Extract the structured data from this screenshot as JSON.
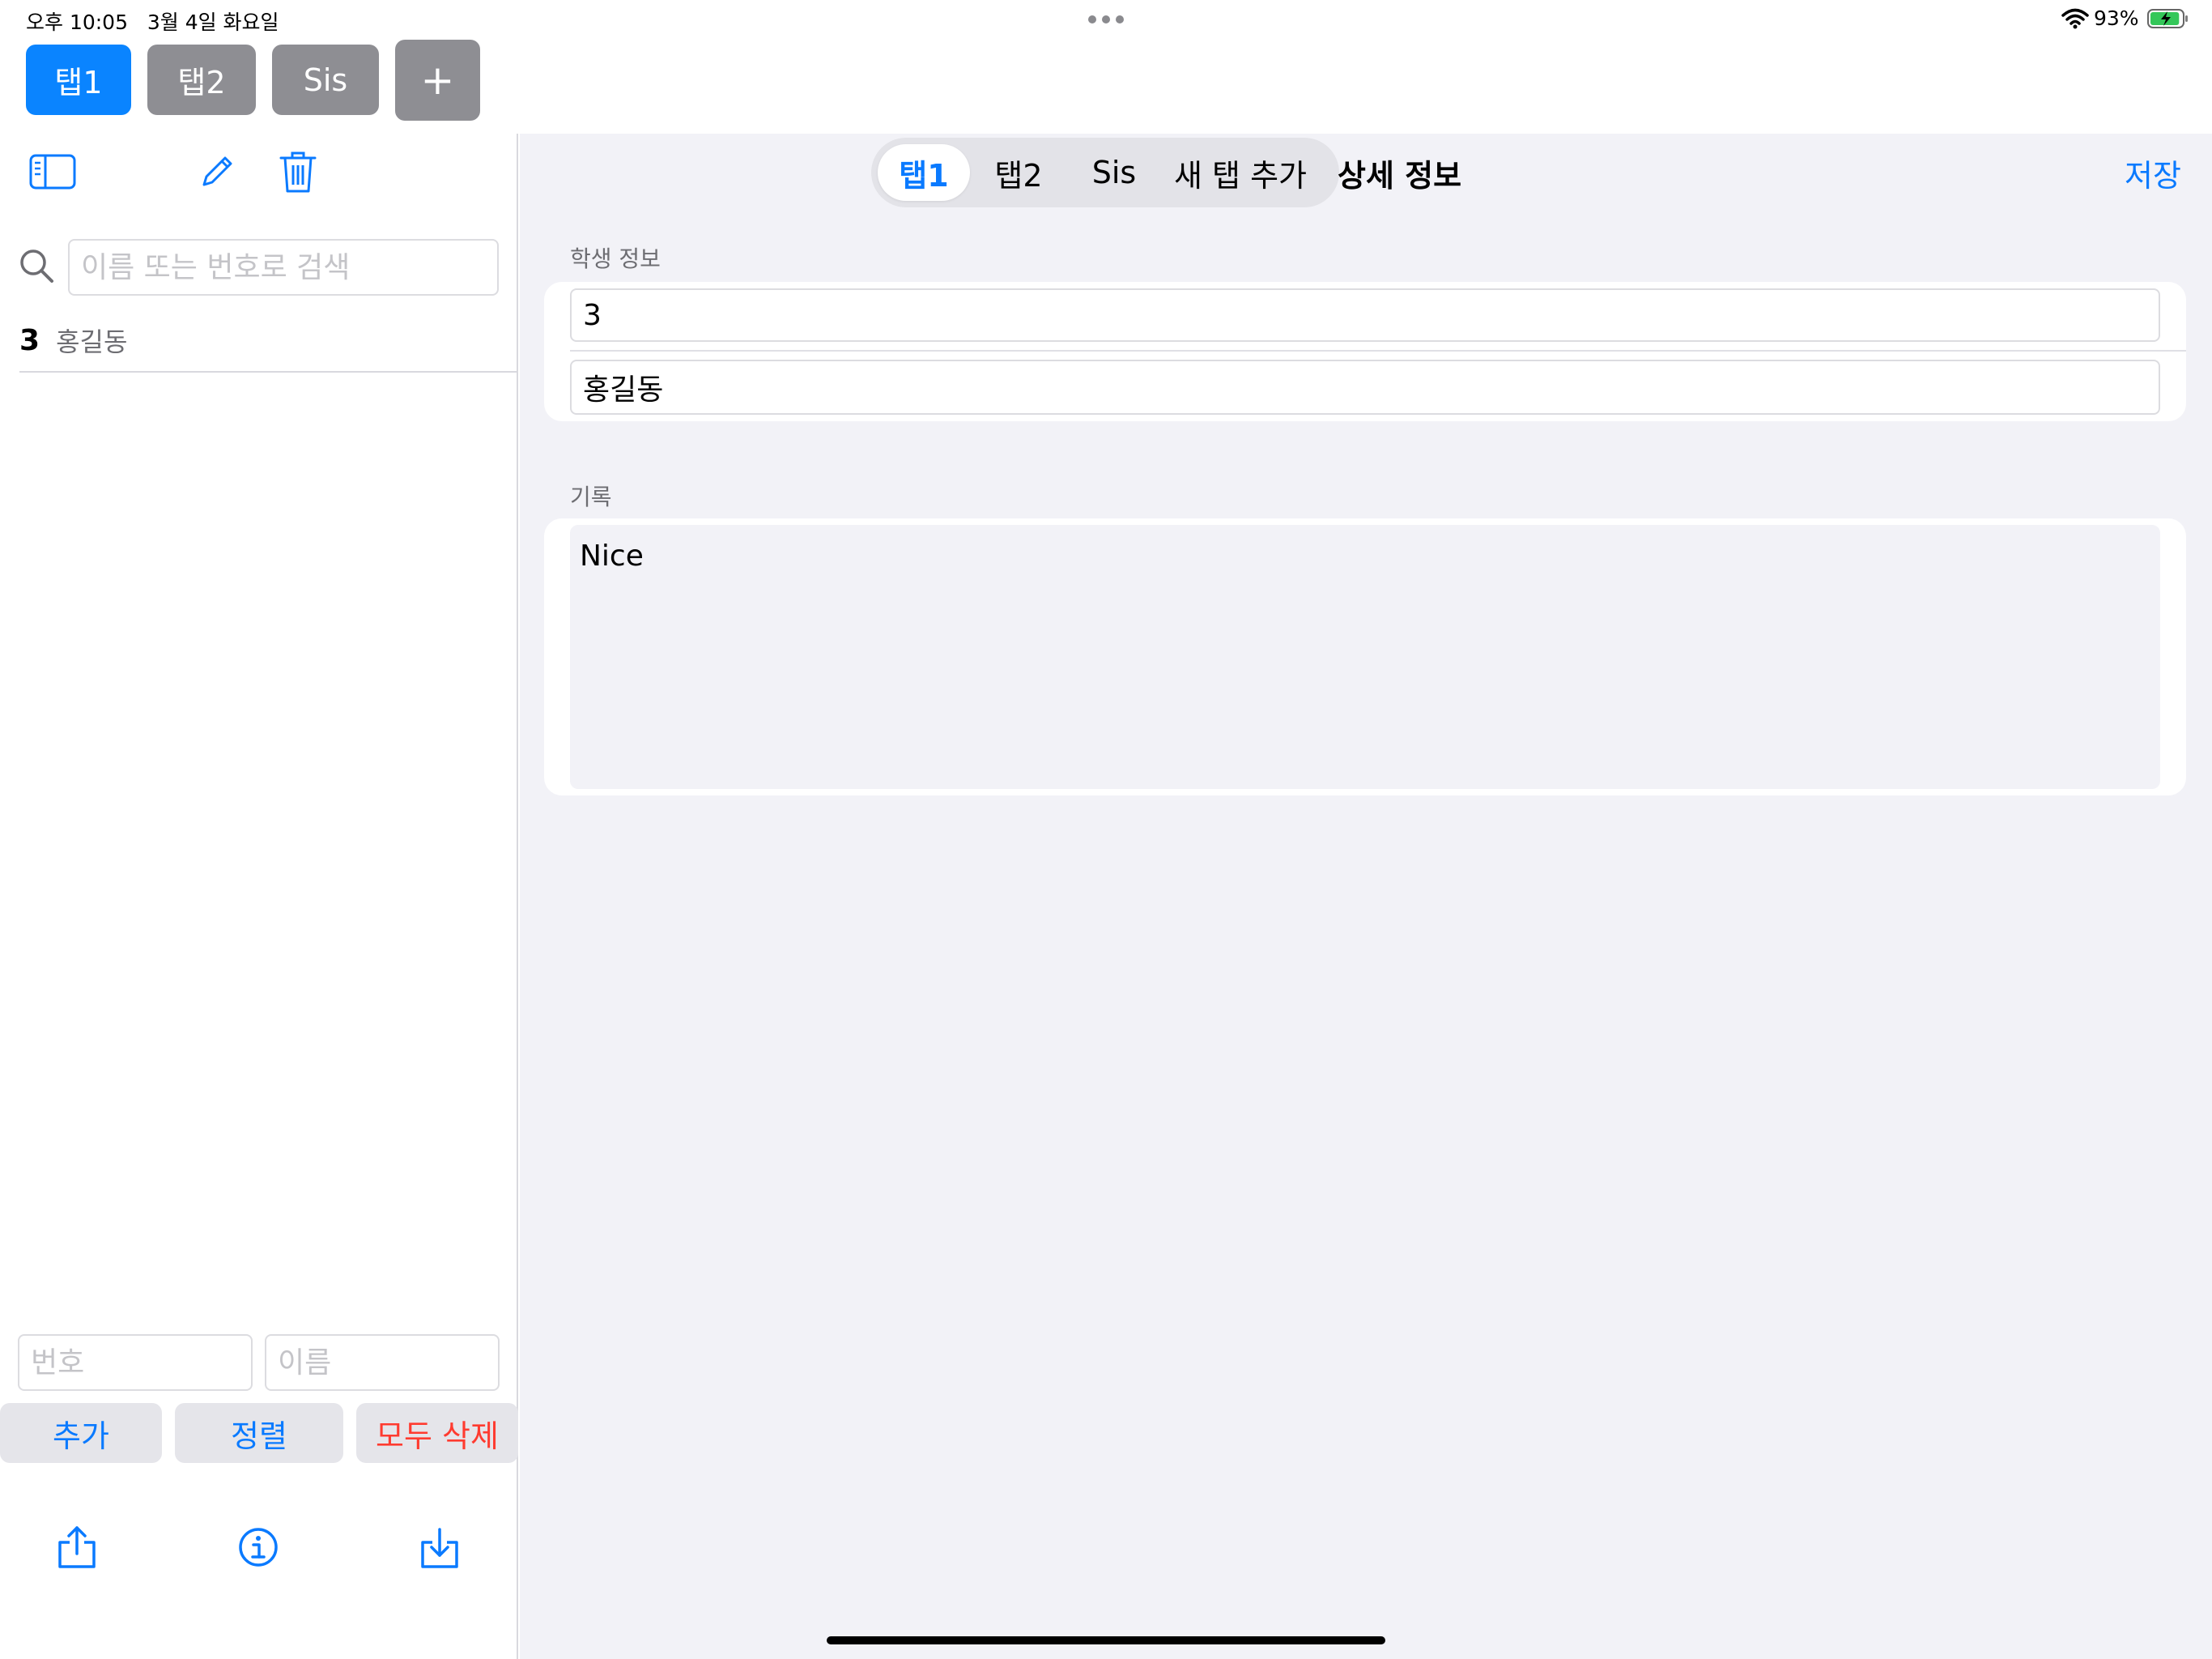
{
  "status_bar": {
    "time": "오후 10:05",
    "date": "3월 4일 화요일",
    "battery_percent": "93%",
    "battery_level": 0.93
  },
  "top_tabs": [
    {
      "label": "탭1",
      "active": true
    },
    {
      "label": "탭2",
      "active": false
    },
    {
      "label": "Sis",
      "active": false
    }
  ],
  "top_add_label": "+",
  "sidebar": {
    "toolbar_icons": [
      "sidebar-toggle-icon",
      "pencil-icon",
      "trash-icon"
    ],
    "search": {
      "placeholder": "이름 또는 번호로 검색",
      "value": ""
    },
    "list": [
      {
        "number": "3",
        "name": "홍길동"
      }
    ],
    "number_field_placeholder": "번호",
    "name_field_placeholder": "이름",
    "add_label": "추가",
    "sort_label": "정렬",
    "delete_all_label": "모두 삭제",
    "bottom_icons": [
      "share-icon",
      "info-icon",
      "download-icon"
    ]
  },
  "detail": {
    "segments": [
      {
        "label": "탭1",
        "active": true
      },
      {
        "label": "탭2",
        "active": false
      },
      {
        "label": "Sis",
        "active": false
      },
      {
        "label": "새 탭 추가",
        "active": false
      }
    ],
    "title": "상세 정보",
    "save_label": "저장",
    "student_section_header": "학생 정보",
    "student_number": "3",
    "student_name": "홍길동",
    "record_section_header": "기록",
    "record_text": "Nice"
  },
  "colors": {
    "accent": "#0a7aff",
    "active_tab": "#0a84ff",
    "inactive_tab": "#8e8e93",
    "destructive": "#ff3b30",
    "detail_background": "#f2f2f7"
  }
}
